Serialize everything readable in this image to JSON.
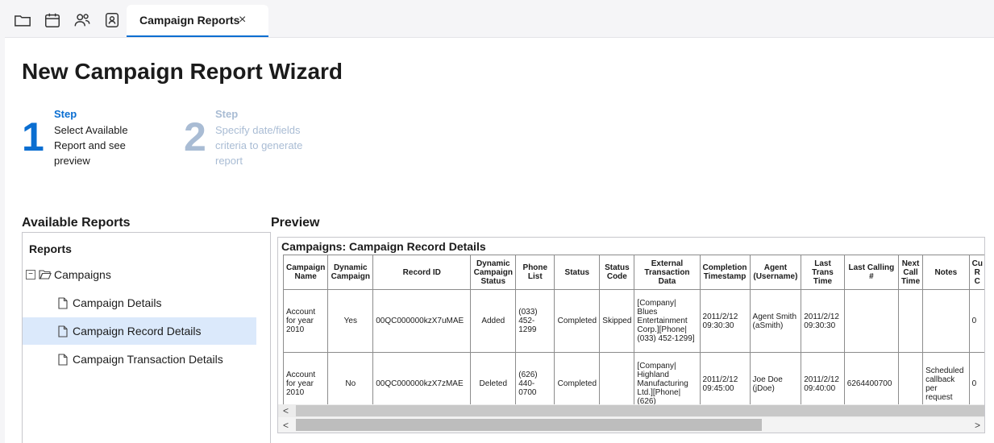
{
  "toolbar": {
    "icons": [
      "folder-icon",
      "calendar-icon",
      "users-icon",
      "contact-icon"
    ]
  },
  "tab": {
    "label": "Campaign Reports",
    "close": "×"
  },
  "page": {
    "title": "New Campaign Report Wizard"
  },
  "steps": [
    {
      "number": "1",
      "head": "Step",
      "desc": "Select Available Report and see preview",
      "color": "#0a6ed1"
    },
    {
      "number": "2",
      "head": "Step",
      "desc": "Specify date/fields criteria to generate report",
      "color": "#a9bcd4"
    }
  ],
  "available_reports": {
    "heading": "Available Reports",
    "panel_title": "Reports",
    "tree": {
      "group": {
        "toggle": "−",
        "label": "Campaigns"
      },
      "items": [
        {
          "label": "Campaign Details"
        },
        {
          "label": "Campaign Record Details",
          "selected": true
        },
        {
          "label": "Campaign Transaction Details"
        }
      ]
    }
  },
  "preview": {
    "heading": "Preview",
    "title": "Campaigns: Campaign Record Details",
    "columns": [
      "Campaign Name",
      "Dynamic Campaign",
      "Record ID",
      "Dynamic Campaign Status",
      "Phone List",
      "Status",
      "Status Code",
      "External Transaction Data",
      "Completion Timestamp",
      "Agent (Username)",
      "Last Trans Time",
      "Last Calling #",
      "Next Call Time",
      "Notes",
      "Cu R C"
    ],
    "rows": [
      [
        "Account for year 2010",
        "Yes",
        "00QC000000kzX7uMAE",
        "Added",
        "(033) 452-1299",
        "Completed",
        "Skipped",
        "[Company| Blues Entertainment Corp.][Phone| (033) 452-1299]",
        "2011/2/12 09:30:30",
        "Agent Smith (aSmith)",
        "2011/2/12 09:30:30",
        "",
        "",
        "",
        "0"
      ],
      [
        "Account for year 2010",
        "No",
        "00QC000000kzX7zMAE",
        "Deleted",
        "(626) 440-0700",
        "Completed",
        "",
        "[Company| Highland Manufacturing Ltd.][Phone| (626)",
        "2011/2/12 09:45:00",
        "Joe Doe (jDoe)",
        "2011/2/12 09:40:00",
        "6264400700",
        "",
        "Scheduled callback per request",
        "0"
      ]
    ],
    "scroll_left": "<",
    "scroll_right": ">"
  }
}
